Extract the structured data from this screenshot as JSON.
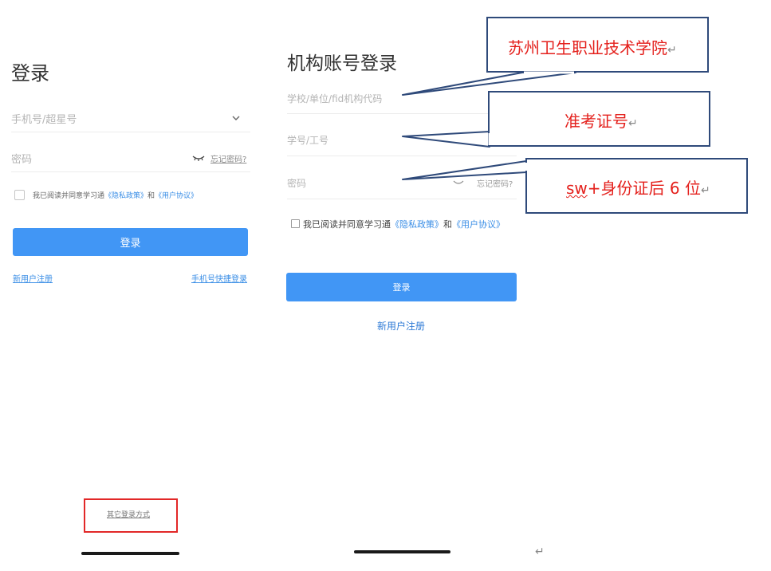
{
  "left_screen": {
    "title": "登录",
    "phone_placeholder": "手机号/超星号",
    "password_placeholder": "密码",
    "forgot_password": "忘记密码?",
    "agreement_prefix": "我已阅读并同意学习通",
    "privacy_policy": "《隐私政策》",
    "agreement_and": "和",
    "user_agreement": "《用户协议》",
    "login_button": "登录",
    "new_user_register": "新用户注册",
    "phone_quick_login": "手机号快捷登录",
    "other_login_methods": "其它登录方式"
  },
  "right_screen": {
    "title": "机构账号登录",
    "school_placeholder": "学校/单位/fid机构代码",
    "student_id_placeholder": "学号/工号",
    "password_placeholder": "密码",
    "forgot_password": "忘记密码?",
    "agreement_prefix": "我已阅读并同意学习通",
    "privacy_policy": "《隐私政策》",
    "agreement_and": "和",
    "user_agreement": "《用户协议》",
    "login_button": "登录",
    "new_user_register": "新用户注册"
  },
  "callouts": {
    "school_hint": "苏州卫生职业技术学院",
    "student_id_hint": "准考证号",
    "password_hint_prefix": "sw",
    "password_hint_rest": "+身份证后 6 位",
    "return_mark": "↵"
  },
  "colors": {
    "accent_blue": "#4196f5",
    "link_blue": "#3a8ee6",
    "callout_red": "#e4201c",
    "callout_border": "#2f4a7a",
    "highlight_box_red": "#e22828"
  }
}
